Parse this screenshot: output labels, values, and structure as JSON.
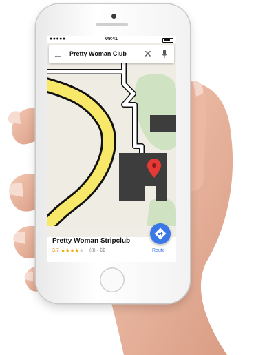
{
  "status_bar": {
    "signal": "●●●●● ",
    "time": "09:41"
  },
  "search": {
    "query": "Pretty Woman Club",
    "back_icon": "arrow-left-icon",
    "clear_icon": "close-icon",
    "mic_icon": "microphone-icon"
  },
  "map": {
    "road_color": "#f8e86a",
    "road_outline": "#111111",
    "building_color": "#3d3d3d",
    "park_color": "#cfe2c1",
    "marker_color": "#e53935"
  },
  "place": {
    "name": "Pretty Woman Stripclub",
    "rating": "3,7",
    "stars": "★★★★",
    "star_empty": "★",
    "reviews": "(8) · $$",
    "route_label": "Route"
  },
  "fab": {
    "icon": "directions-icon",
    "color": "#3b78e7"
  }
}
